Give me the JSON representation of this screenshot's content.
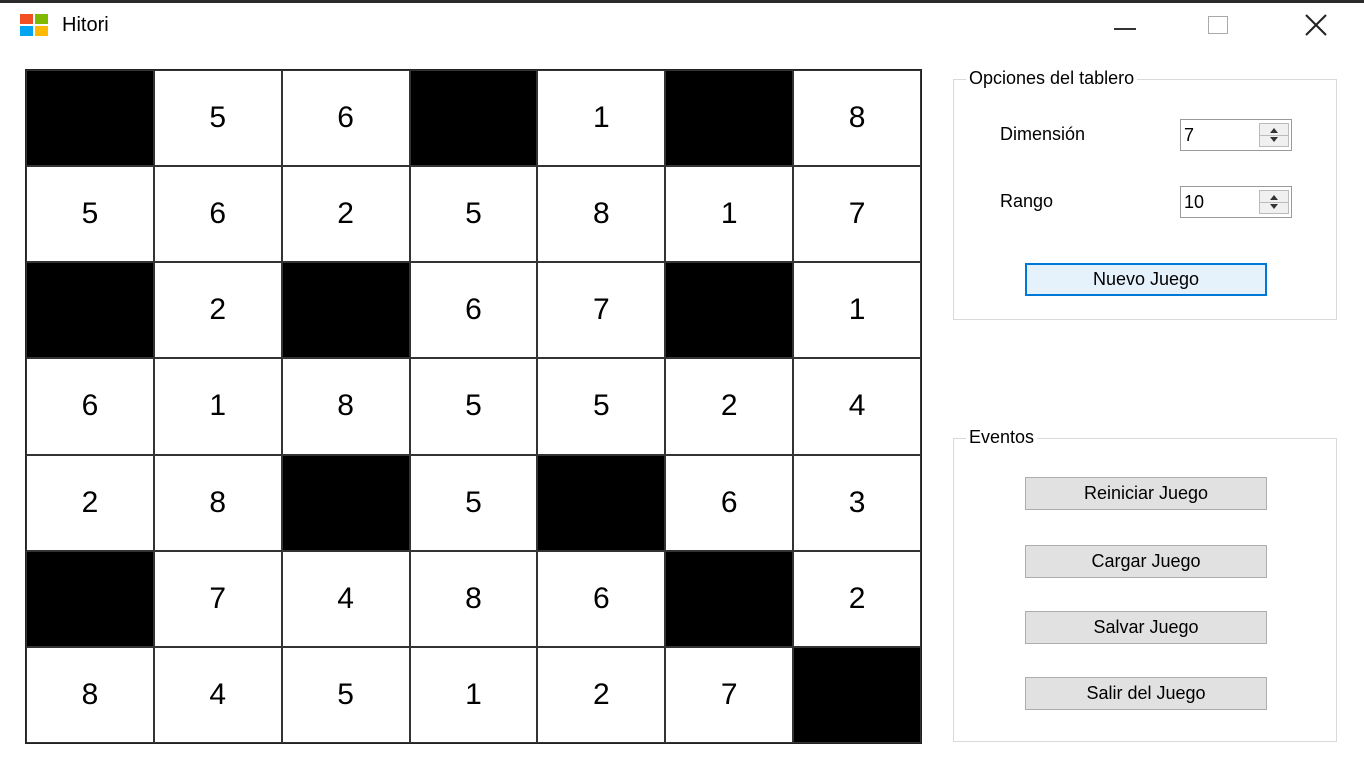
{
  "window": {
    "title": "Hitori",
    "icon": "app-logo-icon",
    "icon_colors": [
      "#f25022",
      "#7fba00",
      "#00a4ef",
      "#ffb900"
    ],
    "controls": {
      "minimize": "minimize-icon",
      "maximize": "maximize-icon",
      "close": "close-icon",
      "close_glyph": "✕"
    }
  },
  "board": {
    "size": 7,
    "rows": [
      [
        {
          "v": "",
          "b": true
        },
        {
          "v": "5",
          "b": false
        },
        {
          "v": "6",
          "b": false
        },
        {
          "v": "",
          "b": true
        },
        {
          "v": "1",
          "b": false
        },
        {
          "v": "",
          "b": true
        },
        {
          "v": "8",
          "b": false
        }
      ],
      [
        {
          "v": "5",
          "b": false
        },
        {
          "v": "6",
          "b": false
        },
        {
          "v": "2",
          "b": false
        },
        {
          "v": "5",
          "b": false
        },
        {
          "v": "8",
          "b": false
        },
        {
          "v": "1",
          "b": false
        },
        {
          "v": "7",
          "b": false
        }
      ],
      [
        {
          "v": "",
          "b": true
        },
        {
          "v": "2",
          "b": false
        },
        {
          "v": "",
          "b": true
        },
        {
          "v": "6",
          "b": false
        },
        {
          "v": "7",
          "b": false
        },
        {
          "v": "",
          "b": true
        },
        {
          "v": "1",
          "b": false
        }
      ],
      [
        {
          "v": "6",
          "b": false
        },
        {
          "v": "1",
          "b": false
        },
        {
          "v": "8",
          "b": false
        },
        {
          "v": "5",
          "b": false
        },
        {
          "v": "5",
          "b": false
        },
        {
          "v": "2",
          "b": false
        },
        {
          "v": "4",
          "b": false
        }
      ],
      [
        {
          "v": "2",
          "b": false
        },
        {
          "v": "8",
          "b": false
        },
        {
          "v": "",
          "b": true
        },
        {
          "v": "5",
          "b": false
        },
        {
          "v": "",
          "b": true
        },
        {
          "v": "6",
          "b": false
        },
        {
          "v": "3",
          "b": false
        }
      ],
      [
        {
          "v": "",
          "b": true
        },
        {
          "v": "7",
          "b": false
        },
        {
          "v": "4",
          "b": false
        },
        {
          "v": "8",
          "b": false
        },
        {
          "v": "6",
          "b": false
        },
        {
          "v": "",
          "b": true
        },
        {
          "v": "2",
          "b": false
        }
      ],
      [
        {
          "v": "8",
          "b": false
        },
        {
          "v": "4",
          "b": false
        },
        {
          "v": "5",
          "b": false
        },
        {
          "v": "1",
          "b": false
        },
        {
          "v": "2",
          "b": false
        },
        {
          "v": "7",
          "b": false
        },
        {
          "v": "",
          "b": true
        }
      ]
    ]
  },
  "options": {
    "legend": "Opciones del tablero",
    "dimension_label": "Dimensión",
    "dimension_value": "7",
    "rango_label": "Rango",
    "rango_value": "10",
    "new_game_label": "Nuevo Juego"
  },
  "events": {
    "legend": "Eventos",
    "restart_label": "Reiniciar Juego",
    "load_label": "Cargar Juego",
    "save_label": "Salvar Juego",
    "exit_label": "Salir del Juego"
  }
}
